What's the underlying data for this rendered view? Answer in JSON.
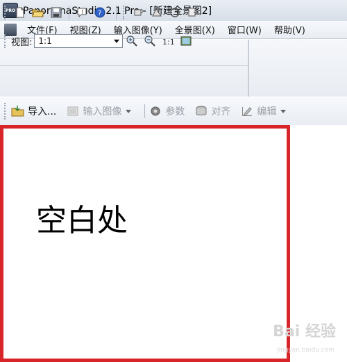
{
  "window": {
    "title": "PanoramaStudio 2.1 Pro - [新建全景图2]",
    "app_icon_text": "PRO"
  },
  "menubar": {
    "items": [
      "文件(F)",
      "视图(Z)",
      "输入图像(Y)",
      "全景图(X)",
      "窗口(W)",
      "帮助(V)"
    ]
  },
  "toolbar": {
    "view_label": "视图:",
    "zoom_value": "1:1"
  },
  "actionbar": {
    "import_label": "导入...",
    "input_images_label": "输入图像",
    "params_label": "参数",
    "align_label": "对齐",
    "edit_label": "编辑"
  },
  "canvas": {
    "blank_label": "空白处"
  },
  "watermark": {
    "text": "Bai 经验",
    "sub": "jingyan.baidu.com"
  },
  "colors": {
    "highlight": "#d8252a"
  }
}
